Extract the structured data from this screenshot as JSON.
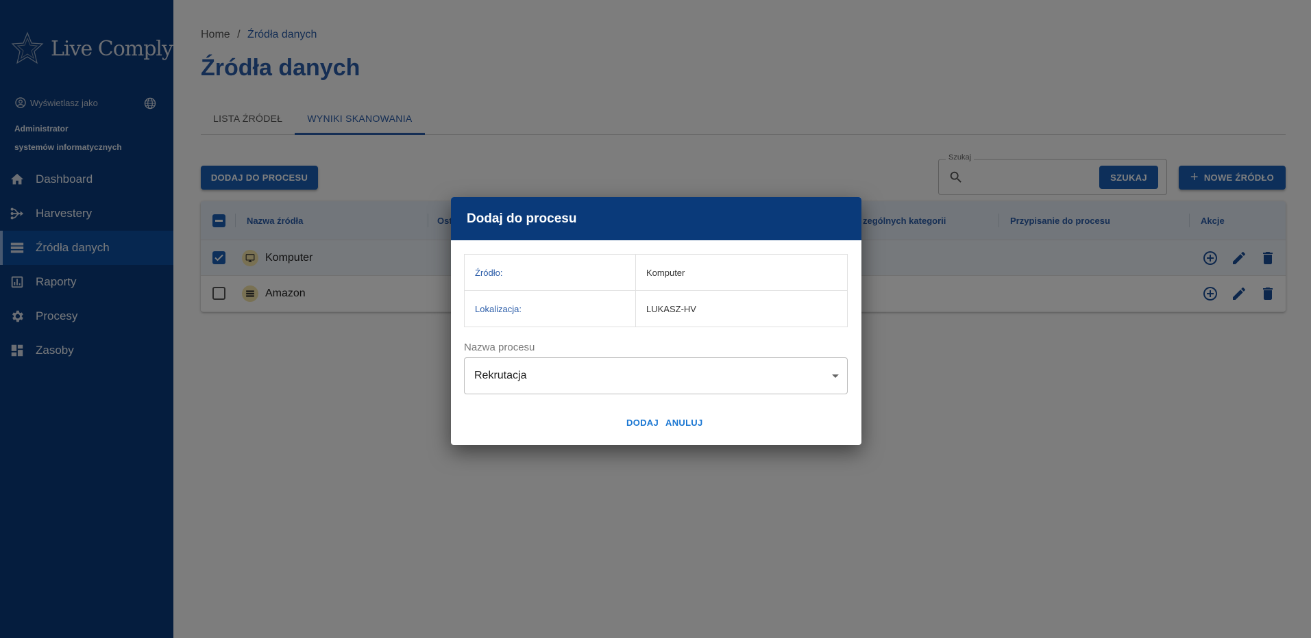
{
  "app": {
    "name": "Live Comply"
  },
  "sidebar": {
    "view_as": "Wyświetlasz jako",
    "role_line1": "Administrator",
    "role_line2": "systemów informatycznych",
    "items": [
      {
        "label": "Dashboard",
        "icon": "home-icon"
      },
      {
        "label": "Harvestery",
        "icon": "harvester-icon"
      },
      {
        "label": "Źródła danych",
        "icon": "storage-icon",
        "active": true
      },
      {
        "label": "Raporty",
        "icon": "chart-icon"
      },
      {
        "label": "Procesy",
        "icon": "gear-icon"
      },
      {
        "label": "Zasoby",
        "icon": "dashboard-grid-icon"
      }
    ]
  },
  "breadcrumb": {
    "home": "Home",
    "sep": "/",
    "current": "Źródła danych"
  },
  "page_title": "Źródła danych",
  "tabs": [
    {
      "label": "LISTA ŹRÓDEŁ"
    },
    {
      "label": "WYNIKI SKANOWANIA",
      "active": true
    }
  ],
  "toolbar": {
    "add_to_process": "DODAJ DO PROCESU",
    "search_label": "Szukaj",
    "search_value": "",
    "search_button": "SZUKAJ",
    "new_source": "NOWE ŹRÓDŁO"
  },
  "table": {
    "columns": [
      "Nazwa źródła",
      "Ost",
      "zególnych kategorii",
      "Przypisanie do procesu",
      "Akcje"
    ],
    "rows": [
      {
        "name": "Komputer",
        "icon": "monitor-icon",
        "checked": true
      },
      {
        "name": "Amazon",
        "icon": "storage-icon",
        "checked": false
      }
    ]
  },
  "dialog": {
    "title": "Dodaj do procesu",
    "source_label": "Źródło:",
    "source_value": "Komputer",
    "location_label": "Lokalizacja:",
    "location_value": "LUKASZ-HV",
    "process_label": "Nazwa procesu",
    "process_value": "Rekrutacja",
    "add": "DODAJ",
    "cancel": "ANULUJ"
  },
  "colors": {
    "sidebar": "#0b3a7c",
    "primary": "#1a5fb4",
    "dialog_header": "#0a3a7a",
    "accent_text": "#2a5ca8"
  }
}
